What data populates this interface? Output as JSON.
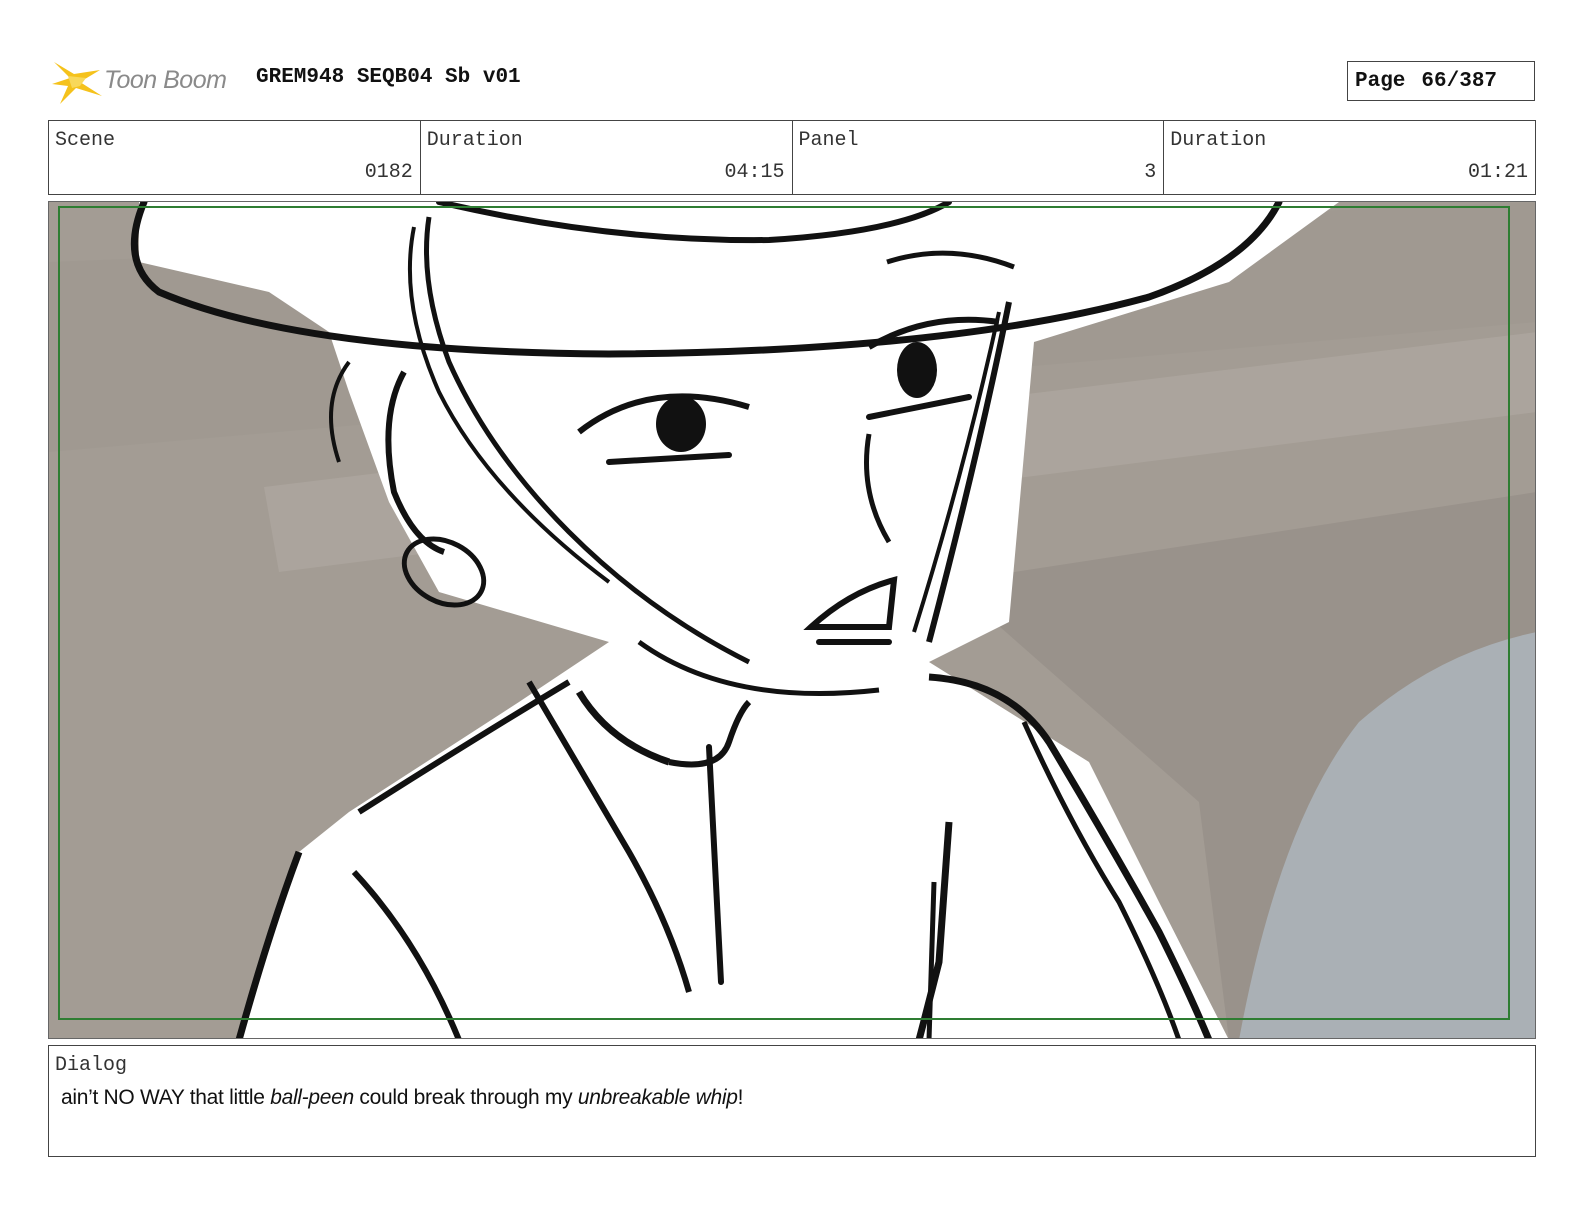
{
  "header": {
    "logo_text": "Toon Boom",
    "document_title": "GREM948 SEQB04 Sb v01",
    "page_label": "Page",
    "page_number": "66/387"
  },
  "info": {
    "scene_label": "Scene",
    "scene_value": "0182",
    "scene_duration_label": "Duration",
    "scene_duration_value": "04:15",
    "panel_label": "Panel",
    "panel_value": "3",
    "panel_duration_label": "Duration",
    "panel_duration_value": "01:21"
  },
  "dialog": {
    "label": "Dialog",
    "segments": {
      "s1": "ain’t NO WAY that little ",
      "s2": "ball-peen",
      "s3": " could break through my ",
      "s4": "unbreakable whip",
      "s5": "!"
    }
  },
  "colors": {
    "safe_frame": "#2e7d32",
    "background_wall": "#a39c94",
    "background_sky": "#aab0b5",
    "logo_star": "#f5c21b"
  }
}
